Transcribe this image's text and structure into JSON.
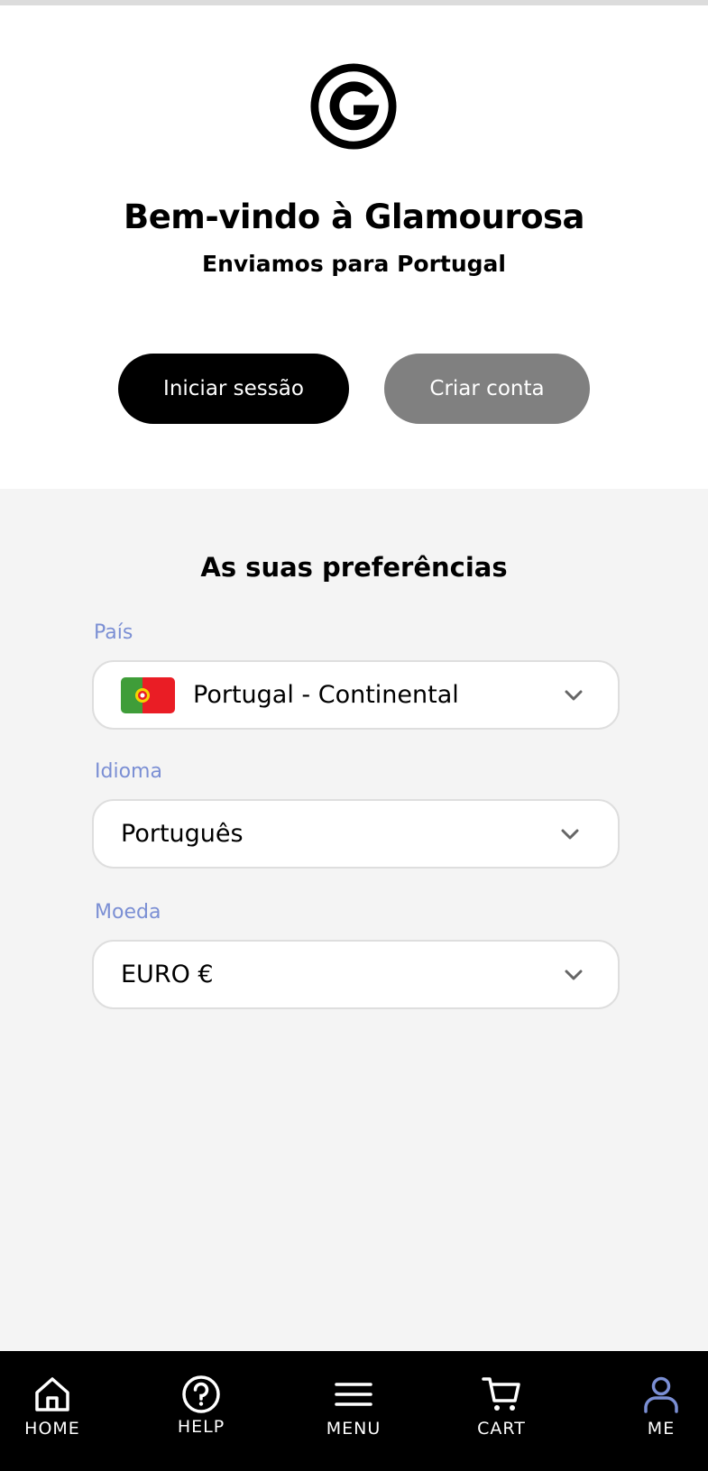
{
  "hero": {
    "welcome": "Bem-vindo à Glamourosa",
    "shipping": "Enviamos para Portugal",
    "login_label": "Iniciar sessão",
    "register_label": "Criar conta"
  },
  "preferences": {
    "title": "As suas preferências",
    "country": {
      "label": "País",
      "value": "Portugal - Continental",
      "flag_icon": "portugal-flag-icon"
    },
    "language": {
      "label": "Idioma",
      "value": "Português"
    },
    "currency": {
      "label": "Moeda",
      "value": "EURO €"
    }
  },
  "tabbar": {
    "home": "HOME",
    "help": "HELP",
    "menu": "MENU",
    "cart": "CART",
    "me": "ME",
    "active": "me"
  },
  "colors": {
    "accent": "#7b8fd4",
    "primary_button": "#000000",
    "secondary_button": "#808080",
    "prefs_background": "#f4f4f4",
    "tabbar_background": "#000000"
  }
}
